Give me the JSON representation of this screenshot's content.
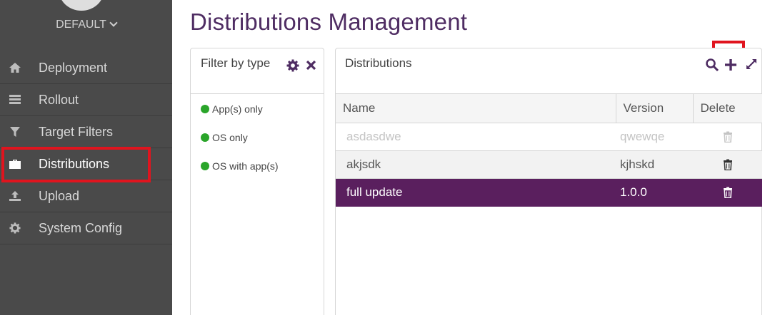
{
  "sidebar": {
    "tenant": "DEFAULT",
    "items": [
      {
        "label": "Deployment",
        "icon": "home-icon"
      },
      {
        "label": "Rollout",
        "icon": "rollout-icon"
      },
      {
        "label": "Target Filters",
        "icon": "filter-icon"
      },
      {
        "label": "Distributions",
        "icon": "briefcase-icon",
        "active": true
      },
      {
        "label": "Upload",
        "icon": "upload-icon"
      },
      {
        "label": "System Config",
        "icon": "gear-icon"
      }
    ]
  },
  "page": {
    "title": "Distributions Management"
  },
  "filter": {
    "title": "Filter by type",
    "options": [
      "App(s) only",
      "OS only",
      "OS with app(s)"
    ]
  },
  "distributions": {
    "title": "Distributions",
    "columns": [
      "Name",
      "Version",
      "Delete"
    ],
    "rows": [
      {
        "name": "asdasdwe",
        "version": "qwewqe"
      },
      {
        "name": "akjsdk",
        "version": "kjhskd"
      },
      {
        "name": "full update",
        "version": "1.0.0"
      }
    ]
  },
  "colors": {
    "accent": "#4f2d63",
    "selected_row": "#5a1f5e",
    "sidebar": "#4a4a4a",
    "highlight": "#e0141e",
    "type_dot": "#2aa52a"
  }
}
